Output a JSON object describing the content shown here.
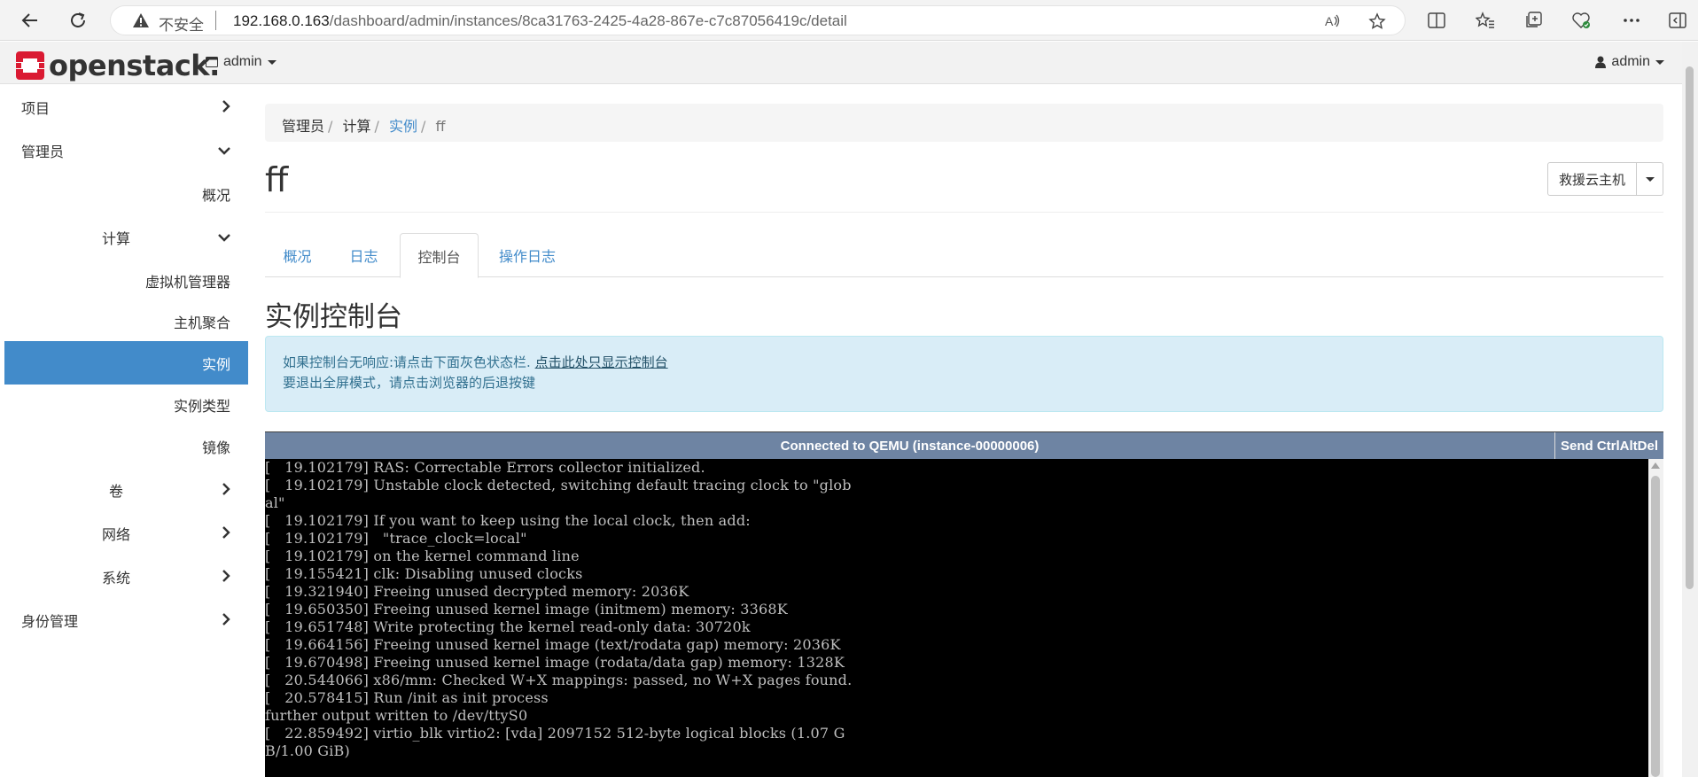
{
  "browser": {
    "insecure_label": "不安全",
    "url_host": "192.168.0.163",
    "url_path": "/dashboard/admin/instances/8ca31763-2425-4a28-867e-c7c87056419c/detail"
  },
  "header": {
    "logo_text": "openstack.",
    "project_menu": "admin",
    "user_menu": "admin"
  },
  "sidebar": {
    "items": [
      {
        "label": "项目"
      },
      {
        "label": "管理员"
      },
      {
        "label": "概况"
      },
      {
        "label": "计算"
      },
      {
        "label": "虚拟机管理器"
      },
      {
        "label": "主机聚合"
      },
      {
        "label": "实例"
      },
      {
        "label": "实例类型"
      },
      {
        "label": "镜像"
      },
      {
        "label": "卷"
      },
      {
        "label": "网络"
      },
      {
        "label": "系统"
      },
      {
        "label": "身份管理"
      }
    ]
  },
  "breadcrumb": [
    "管理员",
    "计算",
    "实例",
    "ff"
  ],
  "page": {
    "title": "ff",
    "action_button": "救援云主机"
  },
  "tabs": [
    "概况",
    "日志",
    "控制台",
    "操作日志"
  ],
  "console_section": {
    "title": "实例控制台",
    "alert_line1": "如果控制台无响应:请点击下面灰色状态栏.",
    "alert_link": "点击此处只显示控制台",
    "alert_line2": "要退出全屏模式，请点击浏览器的后退按键",
    "status": "Connected to QEMU (instance-00000006)",
    "ctrl_alt_del": "Send CtrlAltDel",
    "lines": [
      "[   19.102179] RAS: Correctable Errors collector initialized.",
      "[   19.102179] Unstable clock detected, switching default tracing clock to \"glob",
      "al\"",
      "[   19.102179] If you want to keep using the local clock, then add:",
      "[   19.102179]   \"trace_clock=local\"",
      "[   19.102179] on the kernel command line",
      "[   19.155421] clk: Disabling unused clocks",
      "[   19.321940] Freeing unused decrypted memory: 2036K",
      "[   19.650350] Freeing unused kernel image (initmem) memory: 3368K",
      "[   19.651748] Write protecting the kernel read-only data: 30720k",
      "[   19.664156] Freeing unused kernel image (text/rodata gap) memory: 2036K",
      "[   19.670498] Freeing unused kernel image (rodata/data gap) memory: 1328K",
      "[   20.544066] x86/mm: Checked W+X mappings: passed, no W+X pages found.",
      "[   20.578415] Run /init as init process",
      "",
      "further output written to /dev/ttyS0",
      "[   22.859492] virtio_blk virtio2: [vda] 2097152 512-byte logical blocks (1.07 G",
      "B/1.00 GiB)"
    ]
  },
  "colors": {
    "accent": "#428bca",
    "alert_bg": "#d9edf7",
    "console_bar": "#6e84a3",
    "logo_red": "#da1a32"
  }
}
